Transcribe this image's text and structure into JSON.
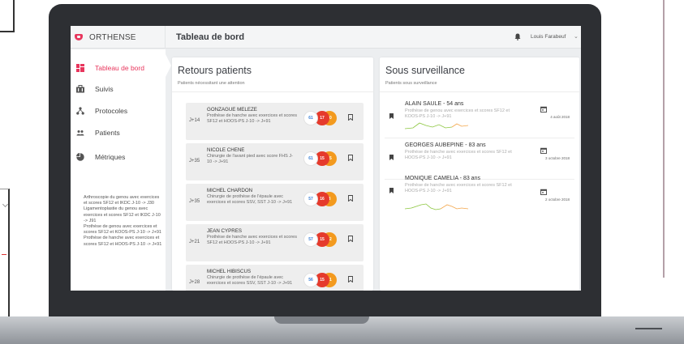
{
  "app": {
    "name": "ORTHENSE",
    "page_title": "Tableau de bord",
    "user": "Louis Farabeuf",
    "colors": {
      "accent": "#e8365d",
      "dark_frame": "#2d2f33",
      "score_blue": "#3a7fd5",
      "score_red": "#e53a2c",
      "score_orange": "#f39a1e",
      "spark_green": "#8cc63f",
      "spark_orange": "#f3a64a"
    }
  },
  "sidebar": {
    "items": [
      {
        "label": "Tableau de bord",
        "icon": "dashboard-icon",
        "active": true
      },
      {
        "label": "Suivis",
        "icon": "briefcase-icon",
        "active": false
      },
      {
        "label": "Protocoles",
        "icon": "hierarchy-icon",
        "active": false
      },
      {
        "label": "Patients",
        "icon": "people-icon",
        "active": false
      },
      {
        "label": "Métriques",
        "icon": "pie-chart-icon",
        "active": false
      }
    ],
    "metrics": [
      "Arthroscopie du genou avec exercices et scores SF12 et IKDC J-10 -> J30",
      "Ligamentoplastie du genou avec exercices et scores SF12 et IKDC J-10 -> J91",
      "Prothèse de genou avec exercices et scores SF12 et KOOS-PS J-10 -> J+91",
      "Prothèse de hanche avec exercices et scores SF12 et HOOS-PS J-10 -> J+91"
    ]
  },
  "retours": {
    "title": "Retours patients",
    "subtitle": "Patients nécessitant une attention",
    "cards": [
      {
        "day": "J+14",
        "name": "GONZAGUE MELEZE",
        "desc": "Prothèse de hanche avec exercices et scores SF12 et HOOS-PS J-10 -> J+91",
        "s1": "61",
        "s2": "17",
        "s3": "30"
      },
      {
        "day": "J+35",
        "name": "NICOLE CHENE",
        "desc": "Chirurgie de l'avant pied avec score FHS J-10 -> J+91",
        "s1": "61",
        "s2": "15",
        "s3": "55"
      },
      {
        "day": "J+35",
        "name": "MICHEL CHARDON",
        "desc": "Chirurgie de prothèse de l'épaule avec exercices et scores SSV, SST J-10 -> J+91",
        "s1": "57",
        "s2": "16",
        "s3": "8"
      },
      {
        "day": "J+21",
        "name": "JEAN CYPRES",
        "desc": "Prothèse de hanche avec exercices et scores SF12 et HOOS-PS J-10 -> J+91",
        "s1": "57",
        "s2": "15",
        "s3": "12"
      },
      {
        "day": "J+28",
        "name": "MICHEL HIBISCUS",
        "desc": "Chirurgie de prothèse de l'épaule avec exercices et scores SSV, SST J-10 -> J+91",
        "s1": "56",
        "s2": "15",
        "s3": "51"
      }
    ]
  },
  "surveillance": {
    "title": "Sous surveillance",
    "subtitle": "Patients sous surveillance",
    "items": [
      {
        "name": "ALAIN SAULE - 54 ans",
        "desc": "Prothèse de genou avec exercices et scores SF12 et KOOS-PS J-10 -> J+91",
        "date": "4 août 2018"
      },
      {
        "name": "GEORGES AUBEPINE - 83 ans",
        "desc": "Prothèse de hanche avec exercices et scores SF12 et HOOS-PS J-10 -> J+91",
        "date": "3 octobre 2018"
      },
      {
        "name": "MONIQUE CAMELIA - 83 ans",
        "desc": "Prothèse de hanche avec exercices et scores SF12 et HOOS-PS J-10 -> J+91",
        "date": "2 octobre 2018"
      }
    ]
  }
}
